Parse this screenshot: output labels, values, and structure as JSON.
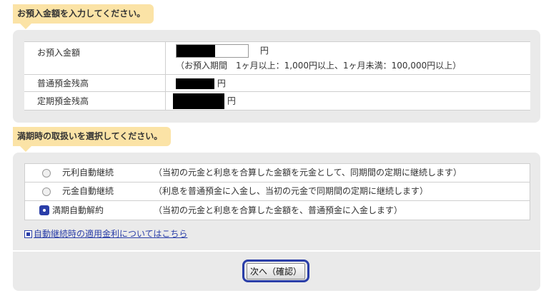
{
  "deposit_section": {
    "heading": "お預入金額を入力してください。",
    "rows": {
      "deposit_amount": {
        "label": "お預入金額",
        "unit": "円",
        "note": "（お預入期間　1ヶ月以上：1,000円以上、1ヶ月未満：100,000円以上）"
      },
      "ordinary_balance": {
        "label": "普通預金残高",
        "unit": "円"
      },
      "fixed_balance": {
        "label": "定期預金残高",
        "unit": "円"
      }
    }
  },
  "maturity_section": {
    "heading": "満期時の取扱いを選択してください。",
    "options": [
      {
        "name": "元利自動継続",
        "desc": "（当初の元金と利息を合算した金額を元金として、同期間の定期に継続します）",
        "selected": false
      },
      {
        "name": "元金自動継続",
        "desc": "（利息を普通預金に入金し、当初の元金で同期間の定期に継続します）",
        "selected": false
      },
      {
        "name": "満期自動解約",
        "desc": "（当初の元金と利息を合算した金額を、普通預金に入金します）",
        "selected": true
      }
    ],
    "rate_link": "自動継続時の適用金利についてはこちら"
  },
  "actions": {
    "next_label": "次へ（確認）"
  },
  "colors": {
    "heading_bg": "#fbe3a6",
    "panel_bg": "#eaeaea",
    "accent": "#2a3ea8"
  }
}
